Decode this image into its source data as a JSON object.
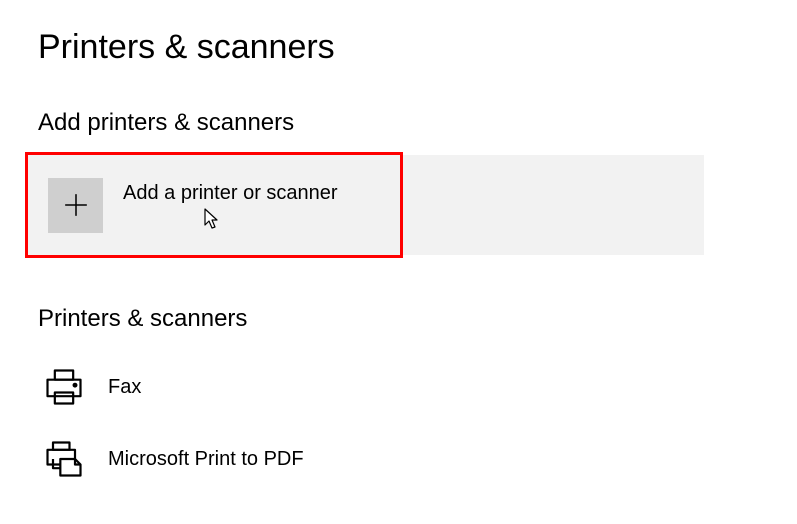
{
  "page": {
    "title": "Printers & scanners"
  },
  "sections": {
    "add": {
      "header": "Add printers & scanners",
      "button_label": "Add a printer or scanner"
    },
    "devices": {
      "header": "Printers & scanners",
      "items": [
        {
          "label": "Fax",
          "icon": "printer-icon"
        },
        {
          "label": "Microsoft Print to PDF",
          "icon": "print-to-file-icon"
        }
      ]
    }
  }
}
